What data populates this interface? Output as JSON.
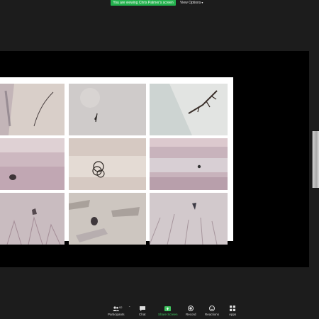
{
  "banner": {
    "text": "You are viewing Chris Palmer's screen"
  },
  "view_options": {
    "label": "View Options"
  },
  "toolbar": {
    "participants_label": "Participants",
    "participants_count": "92",
    "chat_label": "Chat",
    "share_label": "Share Screen",
    "record_label": "Record",
    "reactions_label": "Reactions",
    "apps_label": "Apps"
  },
  "colors": {
    "banner_green": "#23b14d",
    "share_green": "#3ec45e",
    "background": "#1c1c1c"
  },
  "icons": [
    "chevron-down-icon",
    "participants-icon",
    "chat-icon",
    "share-screen-icon",
    "record-icon",
    "reactions-icon",
    "apps-icon"
  ]
}
